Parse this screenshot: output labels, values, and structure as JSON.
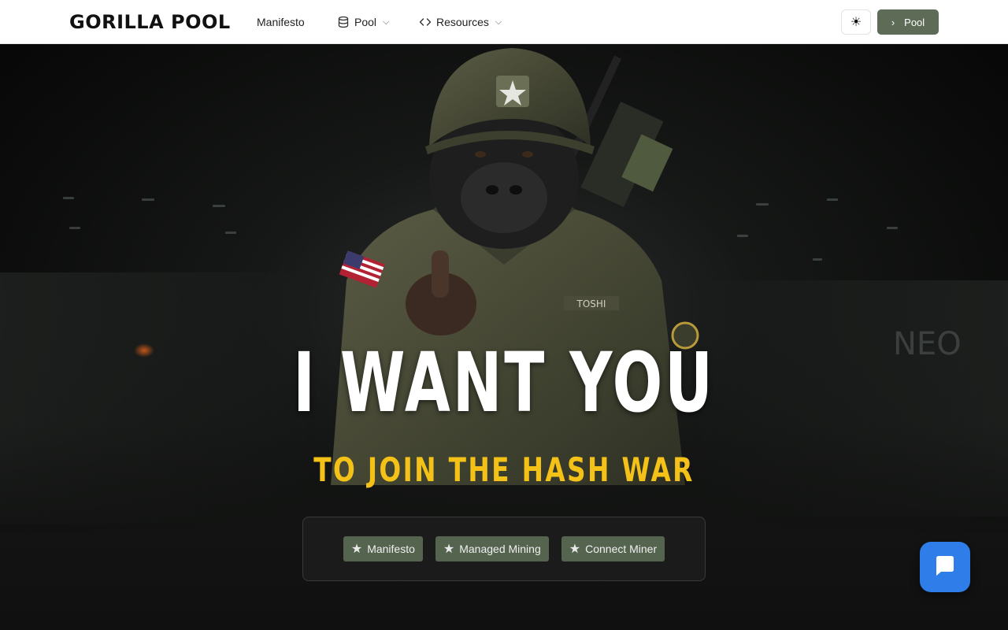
{
  "header": {
    "logo": "GORILLA POOL",
    "nav": [
      {
        "label": "Manifesto",
        "icon": "",
        "has_dropdown": false
      },
      {
        "label": "Pool",
        "icon": "database-icon",
        "has_dropdown": true
      },
      {
        "label": "Resources",
        "icon": "code-icon",
        "has_dropdown": true
      }
    ],
    "theme_toggle_icon": "sun-icon",
    "pool_button_label": "Pool",
    "pool_button_icon": "chevron-right-icon"
  },
  "hero": {
    "headline": "I WANT YOU",
    "subheadline": "TO JOIN THE HASH WAR",
    "patch_name": "TOSHI",
    "background_text": "NEO",
    "cta_buttons": [
      {
        "label": "Manifesto",
        "icon": "star-icon"
      },
      {
        "label": "Managed Mining",
        "icon": "star-icon"
      },
      {
        "label": "Connect Miner",
        "icon": "star-icon"
      }
    ]
  },
  "chat_widget_icon": "chat-bubble-icon",
  "colors": {
    "accent_yellow": "#f3c118",
    "button_green": "#55644f",
    "header_button_green": "#5d6b57",
    "chat_blue": "#2f7de8"
  }
}
